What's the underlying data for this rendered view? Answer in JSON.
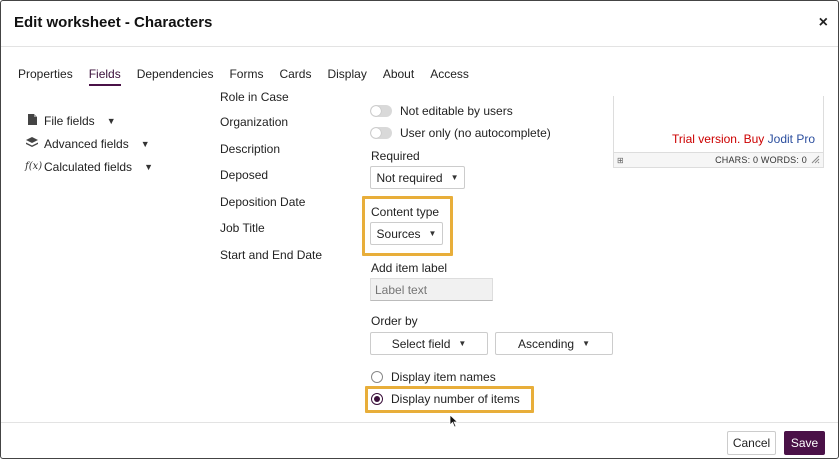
{
  "dialog": {
    "title": "Edit worksheet - Characters",
    "close_label": "×"
  },
  "tabs": [
    {
      "label": "Properties",
      "active": false
    },
    {
      "label": "Fields",
      "active": true
    },
    {
      "label": "Dependencies",
      "active": false
    },
    {
      "label": "Forms",
      "active": false
    },
    {
      "label": "Cards",
      "active": false
    },
    {
      "label": "Display",
      "active": false
    },
    {
      "label": "About",
      "active": false
    },
    {
      "label": "Access",
      "active": false
    }
  ],
  "sidebar": {
    "items": [
      {
        "label": "File fields",
        "icon": "file-icon"
      },
      {
        "label": "Advanced fields",
        "icon": "layers-icon"
      },
      {
        "label": "Calculated fields",
        "icon": "function-icon"
      }
    ]
  },
  "fields": [
    "Role in Case",
    "Organization",
    "Description",
    "Deposed",
    "Deposition Date",
    "Job Title",
    "Start and End Date"
  ],
  "settings": {
    "toggle_not_editable": "Not editable by users",
    "toggle_user_only": "User only (no autocomplete)",
    "required_label": "Required",
    "required_value": "Not required",
    "content_type_label": "Content type",
    "content_type_value": "Sources",
    "add_item_label": "Add item label",
    "add_item_placeholder": "Label text",
    "order_by_label": "Order by",
    "order_field_value": "Select field",
    "order_direction_value": "Ascending",
    "radio_names": "Display item names",
    "radio_count": "Display number of items",
    "selected_display": "Display number of items"
  },
  "editor": {
    "trial_text": "Trial version. Buy ",
    "trial_link": "Jodit Pro",
    "status": "CHARS: 0   WORDS: 0"
  },
  "footer": {
    "cancel_label": "Cancel",
    "save_label": "Save"
  },
  "colors": {
    "accent": "#4a1147",
    "highlight": "#e8ae3a",
    "trial_red": "#cc0000",
    "link_blue": "#2b4e9e"
  }
}
